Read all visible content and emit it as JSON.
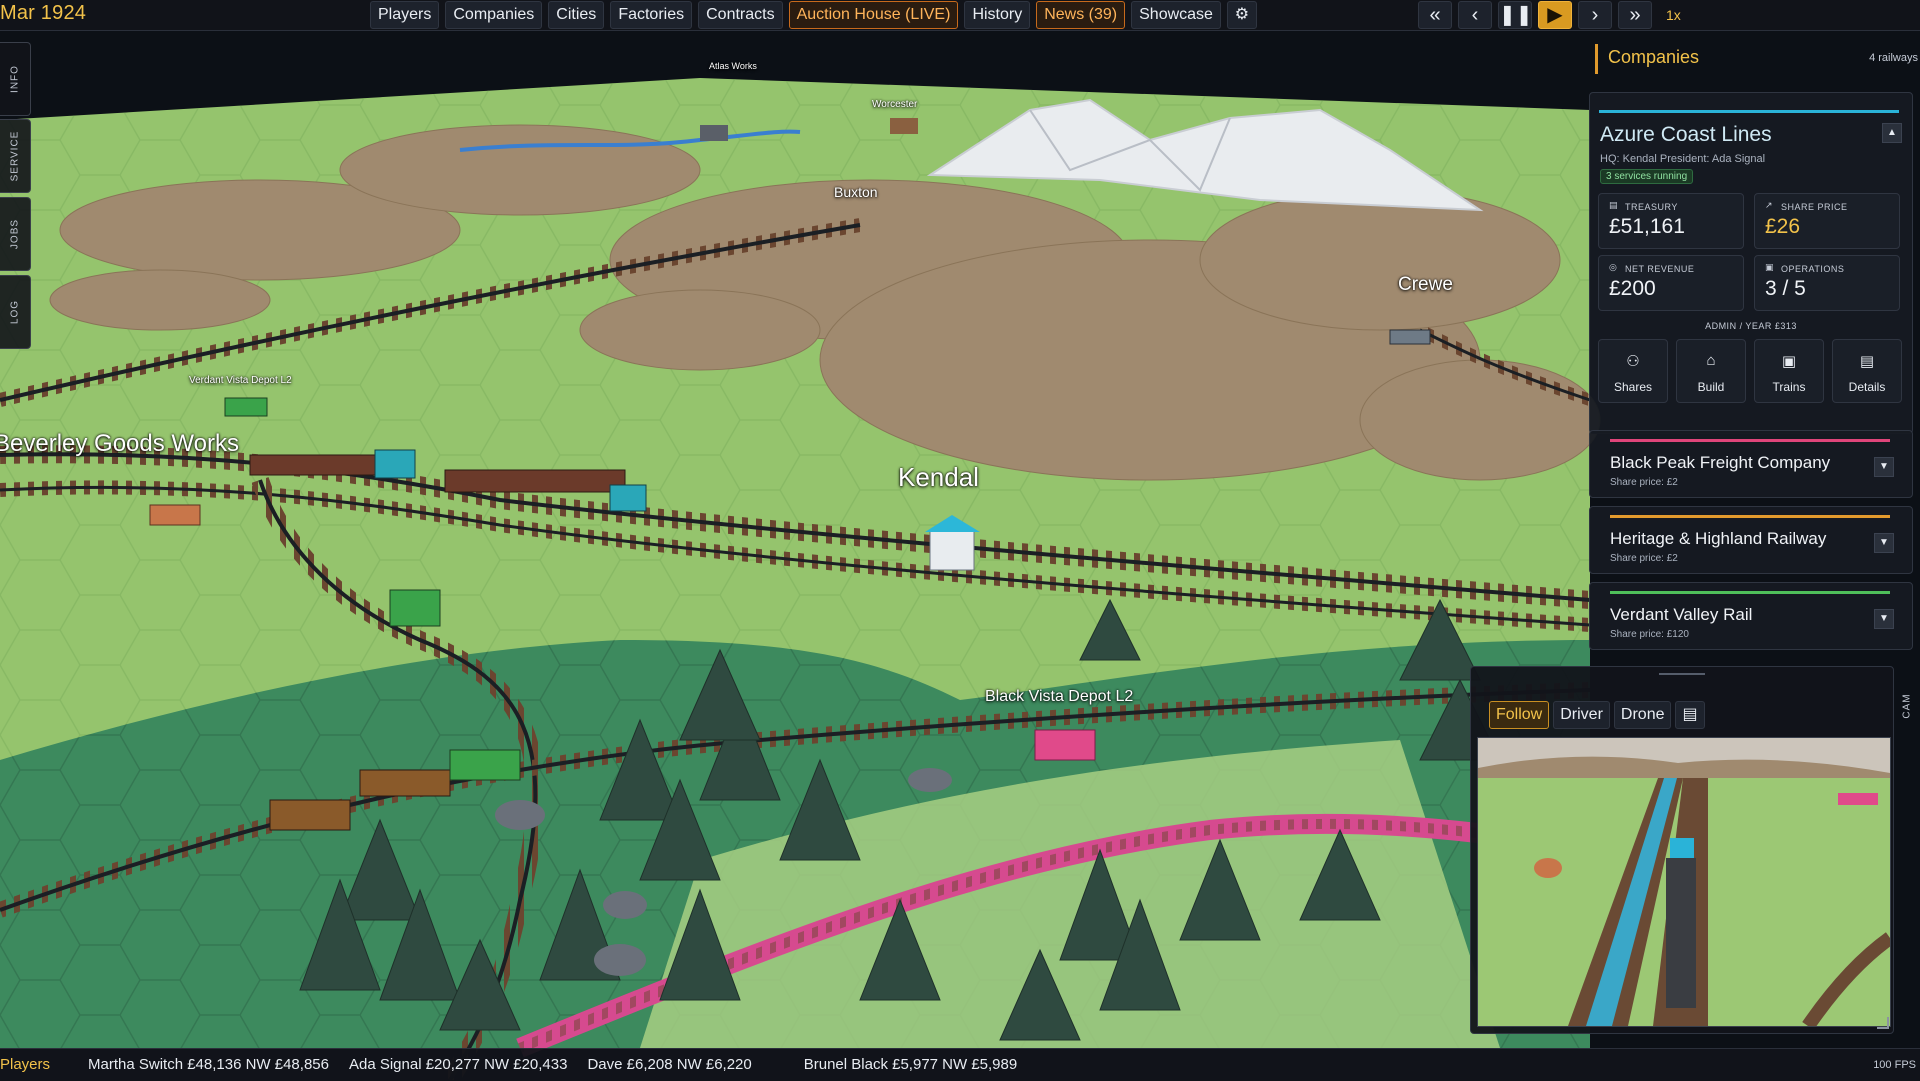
{
  "date": "Mar 1924",
  "nav": [
    "Players",
    "Companies",
    "Cities",
    "Factories",
    "Contracts",
    "Auction House (LIVE)",
    "History",
    "News (39)",
    "Showcase"
  ],
  "nav_settings_icon": "gear-icon",
  "playback": {
    "speed": "1x"
  },
  "side_tabs": [
    "INFO",
    "SERVICE",
    "JOBS",
    "LOG"
  ],
  "map": {
    "labels": {
      "kendal": "Kendal",
      "crewe": "Crewe",
      "buxton": "Buxton",
      "worcester": "Worcester",
      "atlas": "Atlas Works",
      "beverley": "Beverley Goods Works",
      "verdant_depot": "Verdant Vista Depot L2",
      "black_depot": "Black Vista Depot L2"
    }
  },
  "companies": {
    "title": "Companies",
    "count": "4 railways",
    "expanded": {
      "name": "Azure Coast Lines",
      "hq": "HQ: Kendal   President: Ada Signal",
      "status": "3 services running",
      "stats": {
        "treasury_label": "TREASURY",
        "treasury": "£51,161",
        "share_label": "SHARE PRICE",
        "share": "£26",
        "revenue_label": "NET REVENUE",
        "revenue": "£200",
        "ops_label": "OPERATIONS",
        "ops": "3 / 5"
      },
      "admin": "ADMIN / YEAR   £313",
      "actions": [
        "Shares",
        "Build",
        "Trains",
        "Details"
      ],
      "accent": "#2ab3d8"
    },
    "collapsed": [
      {
        "name": "Black Peak Freight Company",
        "share": "Share price: £2",
        "accent": "#e0457a"
      },
      {
        "name": "Heritage & Highland Railway",
        "share": "Share price: £2",
        "accent": "#e39a2d"
      },
      {
        "name": "Verdant Valley Rail",
        "share": "Share price: £120",
        "accent": "#4fbf5a"
      }
    ]
  },
  "camera": {
    "tabs": [
      "Follow",
      "Driver",
      "Drone"
    ],
    "active": "Follow",
    "side_label": "CAM"
  },
  "players_bar": {
    "label": "Players",
    "players": [
      "Martha Switch  £48,136  NW £48,856",
      "Ada Signal  £20,277  NW £20,433",
      "Dave  £6,208  NW £6,220",
      "Brunel Black  £5,977  NW £5,989"
    ],
    "fps": "100 FPS"
  }
}
